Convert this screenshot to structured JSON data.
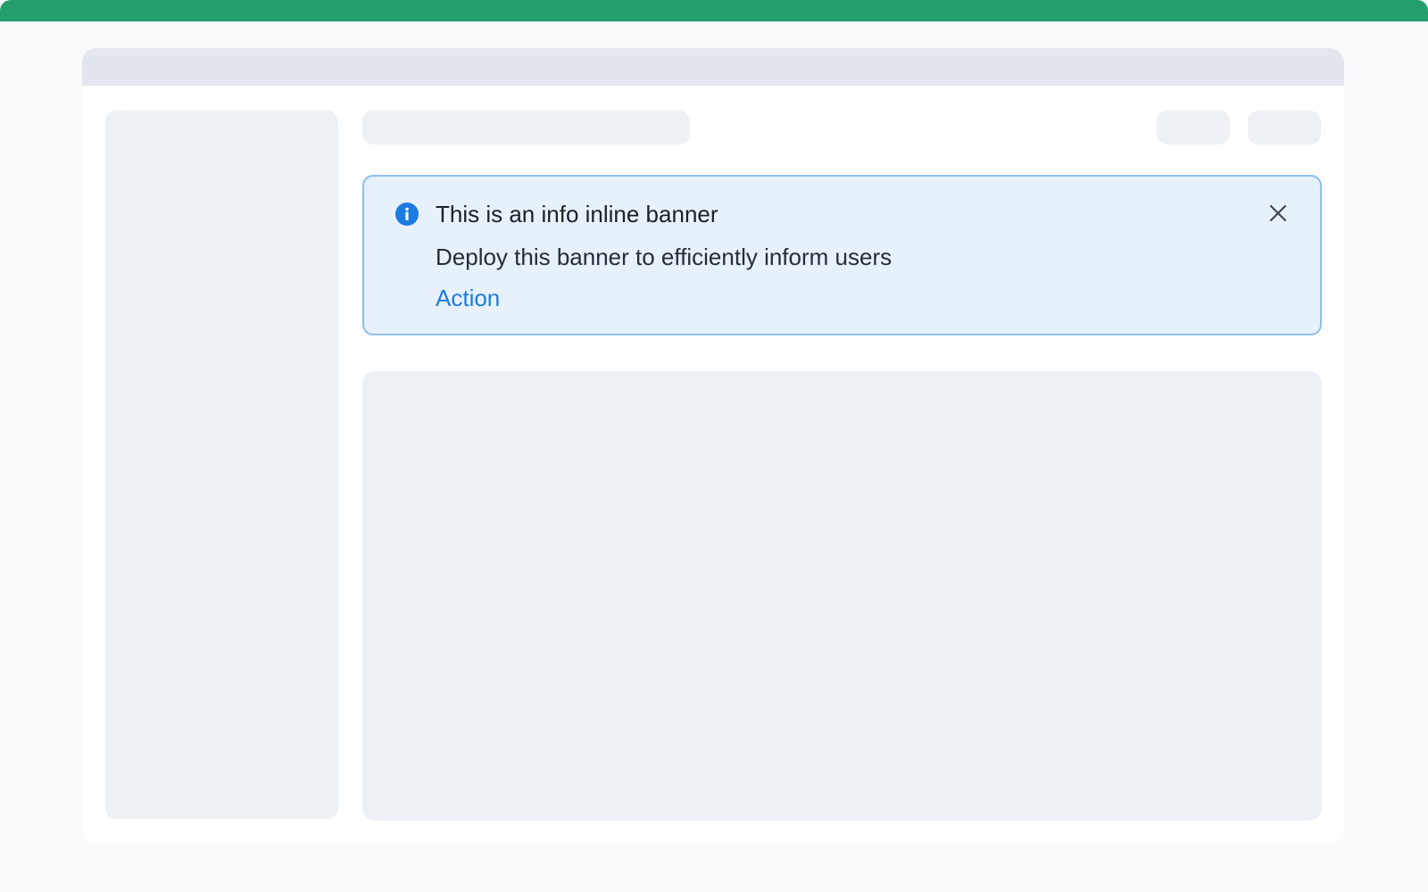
{
  "colors": {
    "accent": "#249e6d",
    "info": "#1d7ae0",
    "banner_bg": "#e7f1fc",
    "banner_border": "#8cbff0"
  },
  "banner": {
    "type": "info",
    "icon": "info-icon",
    "title": "This is an info inline banner",
    "message": "Deploy this banner to efficiently inform users",
    "action_label": "Action",
    "close_icon": "close-icon"
  }
}
